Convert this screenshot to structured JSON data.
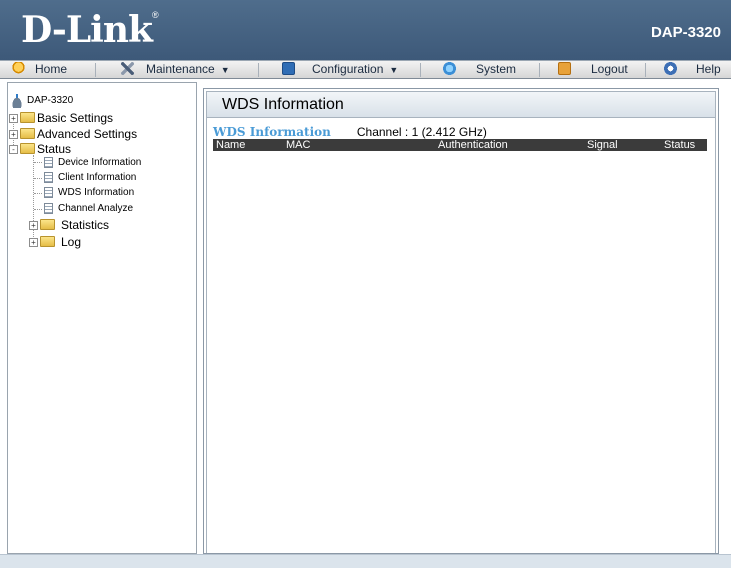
{
  "header": {
    "brand": "D-Link",
    "brand_mark": "®",
    "model": "DAP-3320"
  },
  "nav": {
    "home": "Home",
    "maintenance": "Maintenance",
    "configuration": "Configuration",
    "system": "System",
    "logout": "Logout",
    "help": "Help",
    "caret": "▼"
  },
  "tree": {
    "root": "DAP-3320",
    "basic_settings": "Basic Settings",
    "advanced_settings": "Advanced Settings",
    "status": "Status",
    "device_information": "Device Information",
    "client_information": "Client Information",
    "wds_information": "WDS Information",
    "channel_analyze": "Channel Analyze",
    "statistics": "Statistics",
    "log": "Log",
    "plus": "+",
    "minus": "-"
  },
  "content": {
    "panel_title": "WDS Information",
    "section_title": "WDS Information",
    "channel": "Channel : 1 (2.412 GHz)",
    "columns": [
      "Name",
      "MAC",
      "Authentication",
      "Signal",
      "Status"
    ]
  },
  "colors": {
    "header_bg": "#3d5979",
    "section_title": "#4a9bd6",
    "table_header_bg": "#3b3b3b"
  }
}
